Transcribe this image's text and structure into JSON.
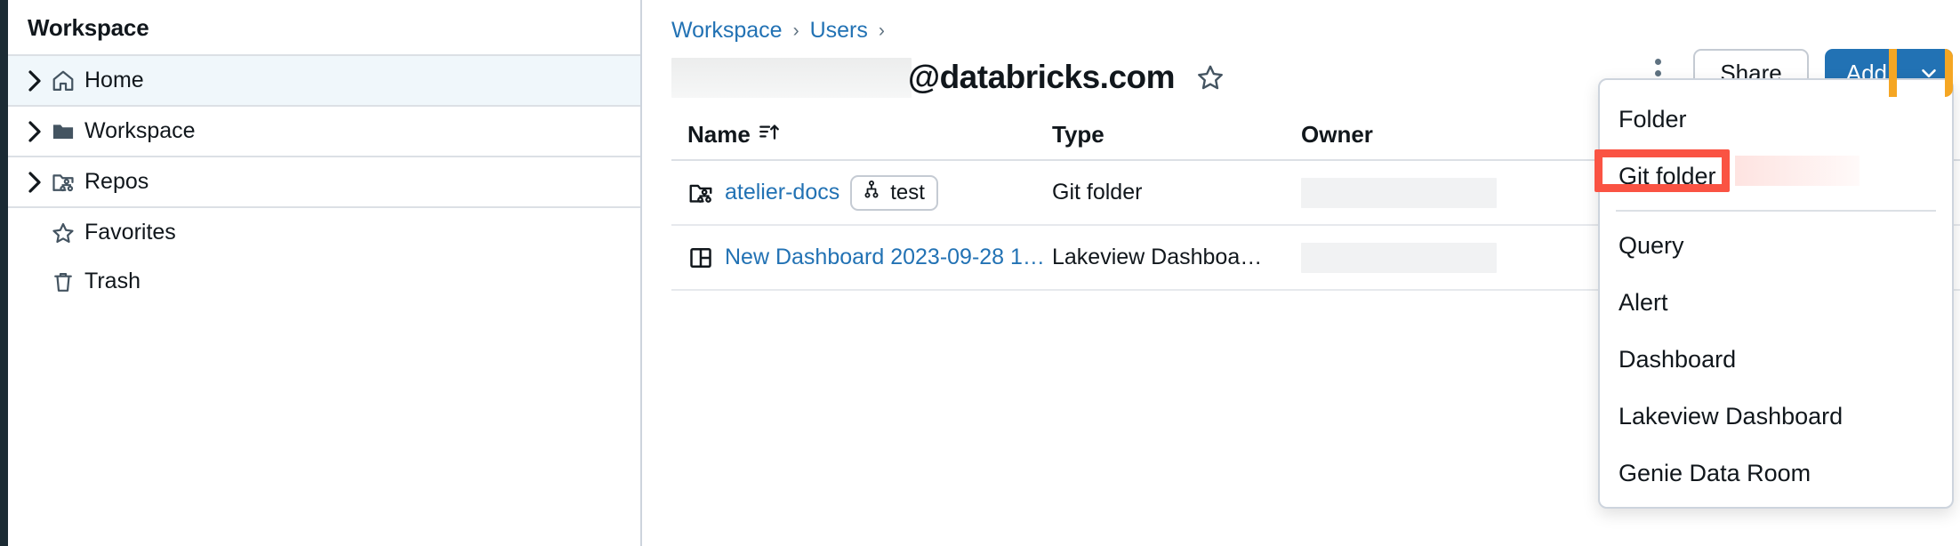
{
  "sidebar": {
    "title": "Workspace",
    "groups": [
      {
        "items": [
          {
            "label": "Home",
            "icon": "home-icon",
            "caret": true,
            "active": true
          }
        ]
      },
      {
        "items": [
          {
            "label": "Workspace",
            "icon": "folder-icon",
            "caret": true,
            "active": false
          }
        ]
      },
      {
        "items": [
          {
            "label": "Repos",
            "icon": "git-folder-icon",
            "caret": true,
            "active": false
          }
        ]
      },
      {
        "items": [
          {
            "label": "Favorites",
            "icon": "star-icon",
            "caret": false,
            "active": false
          },
          {
            "label": "Trash",
            "icon": "trash-icon",
            "caret": false,
            "active": false
          }
        ]
      }
    ]
  },
  "breadcrumb": {
    "items": [
      "Workspace",
      "Users"
    ],
    "separator": "›",
    "trailing_separator": "›"
  },
  "header": {
    "title_redacted": true,
    "title": "@databricks.com",
    "star_icon": "star-outline-icon",
    "kebab_icon": "overflow-menu-icon",
    "share_label": "Share",
    "add_label": "Add",
    "add_caret_icon": "chevron-down-icon"
  },
  "table": {
    "columns": [
      {
        "key": "name",
        "label": "Name",
        "sort_icon": "sort-ascending-icon"
      },
      {
        "key": "type",
        "label": "Type"
      },
      {
        "key": "owner",
        "label": "Owner"
      }
    ],
    "rows": [
      {
        "icon": "git-folder-icon",
        "name": "atelier-docs",
        "badge": {
          "icon": "branch-icon",
          "label": "test"
        },
        "type": "Git folder",
        "owner_redacted": true
      },
      {
        "icon": "dashboard-icon",
        "name": "New Dashboard 2023-09-28 1…",
        "badge": null,
        "type": "Lakeview Dashboa…",
        "owner_redacted": true
      }
    ]
  },
  "add_menu": {
    "visible": true,
    "items": [
      {
        "label": "Folder",
        "highlighted": false,
        "separator_after": false
      },
      {
        "label": "Git folder",
        "highlighted": true,
        "separator_after": true
      },
      {
        "label": "Query",
        "highlighted": false,
        "separator_after": false
      },
      {
        "label": "Alert",
        "highlighted": false,
        "separator_after": false
      },
      {
        "label": "Dashboard",
        "highlighted": false,
        "separator_after": false
      },
      {
        "label": "Lakeview Dashboard",
        "highlighted": false,
        "separator_after": false
      },
      {
        "label": "Genie Data Room",
        "highlighted": false,
        "separator_after": false
      }
    ]
  },
  "annotations": {
    "amber_box_target": "add-dropdown-caret",
    "amber_color": "#f5a623",
    "red_box_target": "menu-item-git-folder",
    "red_color": "#fa5343"
  },
  "colors": {
    "link": "#2272b4",
    "primary_button": "#2272b4",
    "rail": "#1b2b34",
    "active_row": "#f0f7fb",
    "border": "#cdd4dd"
  }
}
